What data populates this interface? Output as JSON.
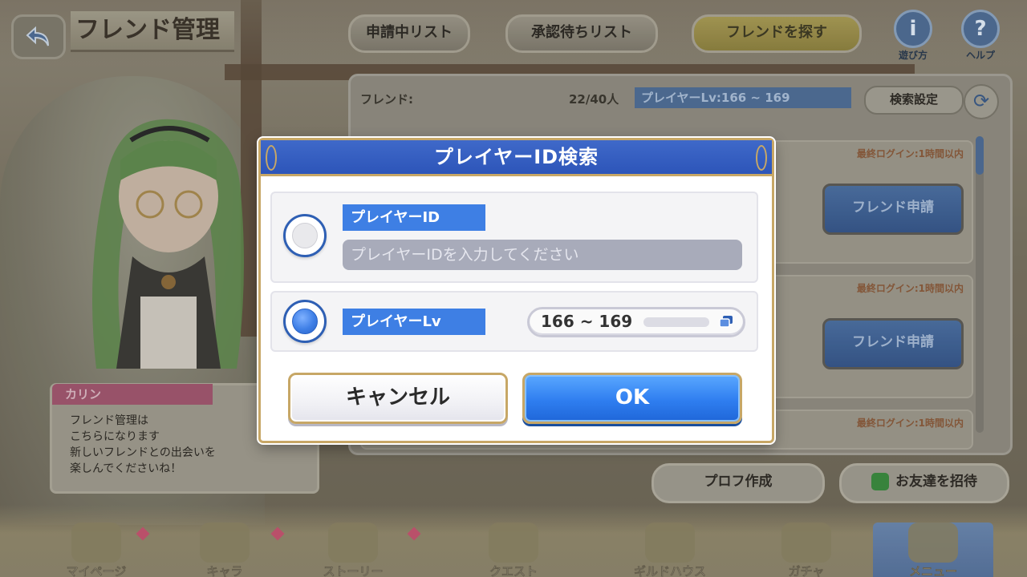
{
  "header": {
    "title": "フレンド管理",
    "tabs": [
      {
        "label": "申請中リスト"
      },
      {
        "label": "承認待ちリスト"
      },
      {
        "label": "フレンドを探す"
      }
    ],
    "how_to_label": "遊び方",
    "help_label": "ヘルプ"
  },
  "friend_panel": {
    "label": "フレンド:",
    "count": "22/40人",
    "filter": "プレイヤーLv:166 ~ 169",
    "search_settings": "検索設定",
    "rows": [
      {
        "last_login": "最終ログイン:1時間以内",
        "request": "フレンド申請"
      },
      {
        "last_login": "最終ログイン:1時間以内",
        "request": "フレンド申請"
      },
      {
        "last_login": "最終ログイン:1時間以内"
      }
    ]
  },
  "profile_button": "プロフ作成",
  "invite_button": "お友達を招待",
  "character": {
    "name": "カリン",
    "message": "フレンド管理は\nこちらになります\n新しいフレンドとの出会いを\n楽しんでくださいね！"
  },
  "bottom_nav": [
    {
      "label": "マイページ"
    },
    {
      "label": "キャラ"
    },
    {
      "label": "ストーリー"
    },
    {
      "label": "クエスト"
    },
    {
      "label": "ギルドハウス"
    },
    {
      "label": "ガチャ"
    },
    {
      "label": "メニュー"
    }
  ],
  "dialog": {
    "title": "プレイヤーID検索",
    "option_id": {
      "label": "プレイヤーID",
      "placeholder": "プレイヤーIDを入力してください",
      "selected": false
    },
    "option_lv": {
      "label": "プレイヤーLv",
      "value": "166 ~ 169",
      "selected": true
    },
    "cancel_label": "キャンセル",
    "ok_label": "OK"
  },
  "colors": {
    "dialog_title_bg": "#2d55b9",
    "accent_blue": "#3e7fe4",
    "gold_border": "#c7a766"
  }
}
